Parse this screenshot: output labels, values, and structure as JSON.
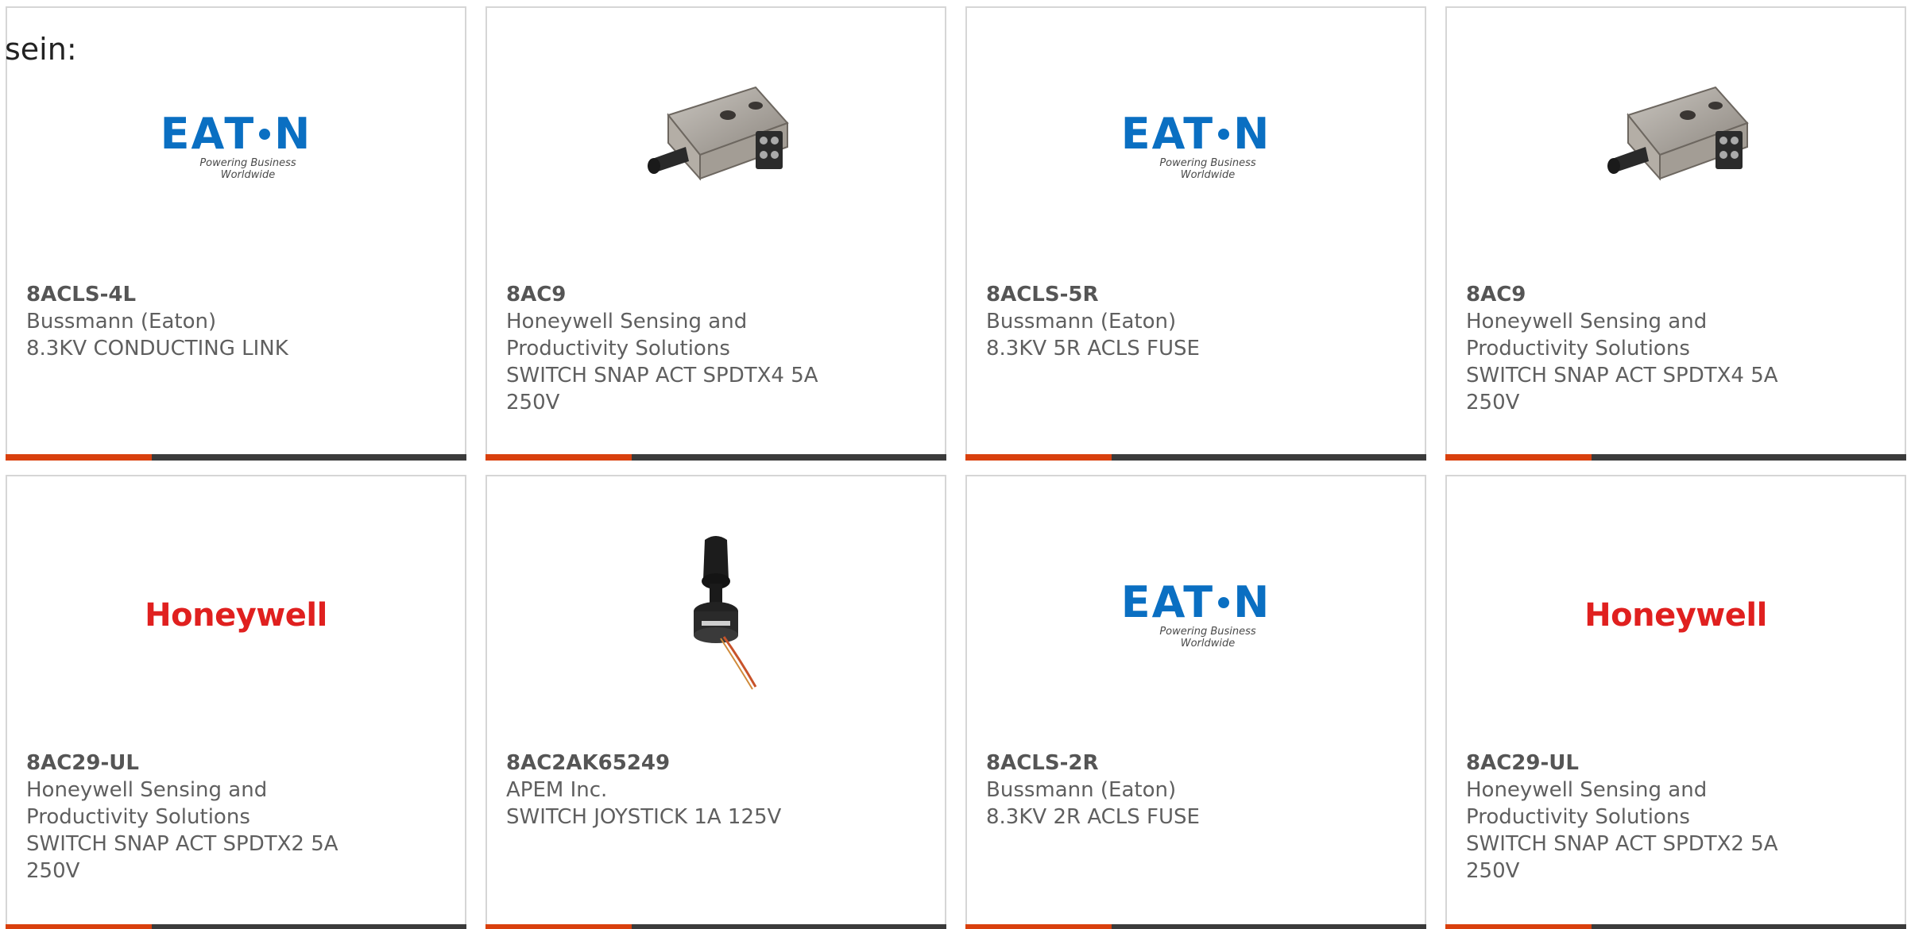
{
  "prefix_text": "sein:",
  "products": [
    {
      "part_number": "8ACLS-4L",
      "manufacturer": "Bussmann (Eaton)",
      "description": "8.3KV CONDUCTING LINK",
      "image": "eaton-logo",
      "logo_text": "EATON",
      "logo_tagline": "Powering Business Worldwide"
    },
    {
      "part_number": "8AC9",
      "manufacturer": "Honeywell Sensing and Productivity Solutions",
      "description": "SWITCH SNAP ACT SPDTX4 5A 250V",
      "image": "snap-switch-photo"
    },
    {
      "part_number": "8ACLS-5R",
      "manufacturer": "Bussmann (Eaton)",
      "description": "8.3KV 5R ACLS FUSE",
      "image": "eaton-logo",
      "logo_text": "EATON",
      "logo_tagline": "Powering Business Worldwide"
    },
    {
      "part_number": "8AC9",
      "manufacturer": "Honeywell Sensing and Productivity Solutions",
      "description": "SWITCH SNAP ACT SPDTX4 5A 250V",
      "image": "snap-switch-photo"
    },
    {
      "part_number": "8AC29-UL",
      "manufacturer": "Honeywell Sensing and Productivity Solutions",
      "description": "SWITCH SNAP ACT SPDTX2 5A 250V",
      "image": "honeywell-logo",
      "logo_text": "Honeywell"
    },
    {
      "part_number": "8AC2AK65249",
      "manufacturer": "APEM Inc.",
      "description": "SWITCH JOYSTICK 1A 125V",
      "image": "joystick-photo"
    },
    {
      "part_number": "8ACLS-2R",
      "manufacturer": "Bussmann (Eaton)",
      "description": "8.3KV 2R ACLS FUSE",
      "image": "eaton-logo",
      "logo_text": "EATON",
      "logo_tagline": "Powering Business Worldwide"
    },
    {
      "part_number": "8AC29-UL",
      "manufacturer": "Honeywell Sensing and Productivity Solutions",
      "description": "SWITCH SNAP ACT SPDTX2 5A 250V",
      "image": "honeywell-logo",
      "logo_text": "Honeywell"
    }
  ],
  "colors": {
    "accent": "#d9400d",
    "bar": "#3b3b3b",
    "eaton_blue": "#0a6fc2",
    "honeywell_red": "#e0201f"
  }
}
